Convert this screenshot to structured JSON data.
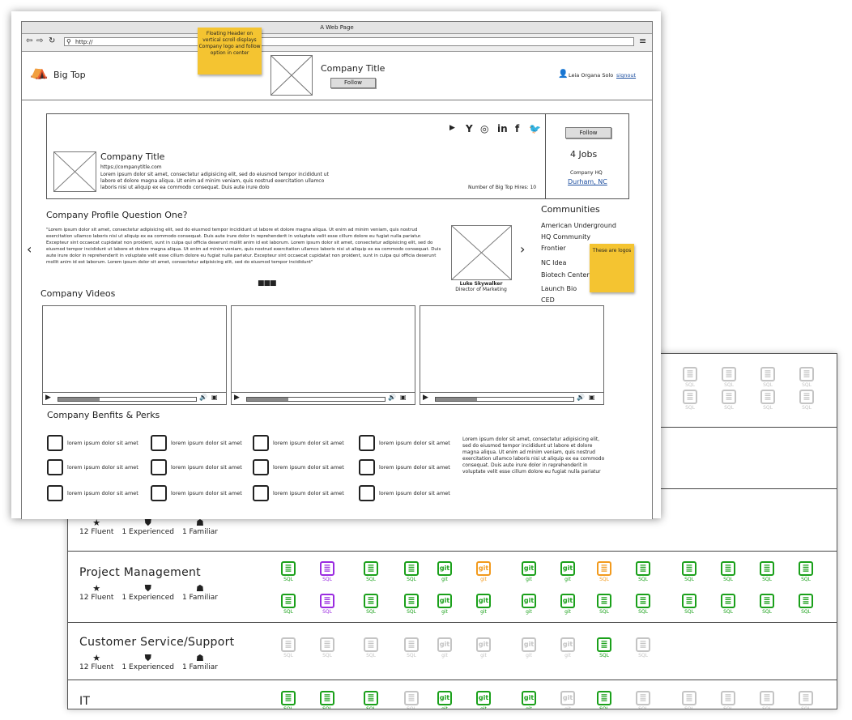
{
  "browser": {
    "title": "A Web Page",
    "url": "http://"
  },
  "notes": {
    "header": "Floating Header on vertical scroll displays Company logo and follow option in center",
    "logos": "These are logos"
  },
  "header": {
    "brand": "Big Top",
    "company_title": "Company Title",
    "follow": "Follow",
    "user": "Leia Organa Solo",
    "signout": "signout"
  },
  "company": {
    "title": "Company Title",
    "url": "https://companytitle.com",
    "desc": "Lorem ipsum dolor sit amet, consectetur adipisicing elit, sed do eiusmod tempor incididunt ut labore et dolore magna aliqua. Ut enim ad minim veniam, quis nostrud exercitation ullamco laboris nisi ut aliquip ex ea commodo consequat. Duis aute irure dolo",
    "hires": "Number of Big Top Hires: 10",
    "social_icons": [
      "youtube-icon",
      "yelp-icon",
      "instagram-icon",
      "linkedin-icon",
      "facebook-icon",
      "twitter-icon"
    ],
    "follow": "Follow",
    "jobs": "4 Jobs",
    "hq_label": "Company HQ",
    "hq_city": "Durham, NC"
  },
  "profile": {
    "question": "Company Profile Question One?",
    "quote": "\"Lorem ipsum dolor sit amet, consectetur adipisicing elit, sed do eiusmod tempor incididunt ut labore et dolore magna aliqua. Ut enim ad minim veniam, quis nostrud exercitation ullamco laboris nisi ut aliquip ex ea commodo consequat. Duis aute irure dolor in reprehenderit in voluptate velit esse cillum dolore eu fugiat nulla pariatur. Excepteur sint occaecat cupidatat non proident, sunt in culpa qui officia deserunt mollit anim id est laborum. Lorem ipsum dolor sit amet, consectetur adipisicing elit, sed do eiusmod tempor incididunt ut labore et dolore magna aliqua. Ut enim ad minim veniam, quis nostrud exercitation ullamco laboris nisi ut aliquip ex ea commodo consequat. Duis aute irure dolor in reprehenderit in voluptate velit esse cillum dolore eu fugiat nulla pariatur. Excepteur sint occaecat cupidatat non proident, sunt in culpa qui officia deserunt mollit anim id est laborum. Lorem ipsum dolor sit amet, consectetur adipisicing elit, sed do eiusmod tempor incididunt\"",
    "person": "Luke Skywalker",
    "role": "Director of Marketing"
  },
  "communities": {
    "title": "Communities",
    "items": [
      "American Underground",
      "HQ Community",
      "Frontier",
      "NC Idea",
      "Biotech Center",
      "Launch Bio",
      "CED"
    ]
  },
  "videos": {
    "title": "Company Videos"
  },
  "perks": {
    "title": "Company Benfits & Perks",
    "item": "lorem ipsum dolor sit amet",
    "desc": "Lorem ipsum dolor sit amet, consectetur adipisicing elit, sed do eiusmod tempor incididunt ut labore et dolore magna aliqua. Ut enim ad minim veniam, quis nostrud exercitation ullamco laboris nisi ut aliquip ex ea commodo consequat. Duis aute irure dolor in reprehenderit in voluptate velit esse cillum dolore eu fugiat nulla pariatur"
  },
  "skills": {
    "stats": {
      "fluent": "12 Fluent",
      "experienced": "1 Experienced",
      "familiar": "1 Familiar"
    },
    "icon_labels": {
      "sql": "SQL",
      "git": "git"
    },
    "colors": {
      "green": "#1aa01a",
      "purple": "#9a2be0",
      "orange": "#f29a1d",
      "gray": "#c4c4c4"
    },
    "rows": [
      {
        "title": "Project Management"
      },
      {
        "title": "Customer Service/Support"
      },
      {
        "title": "IT"
      }
    ]
  }
}
